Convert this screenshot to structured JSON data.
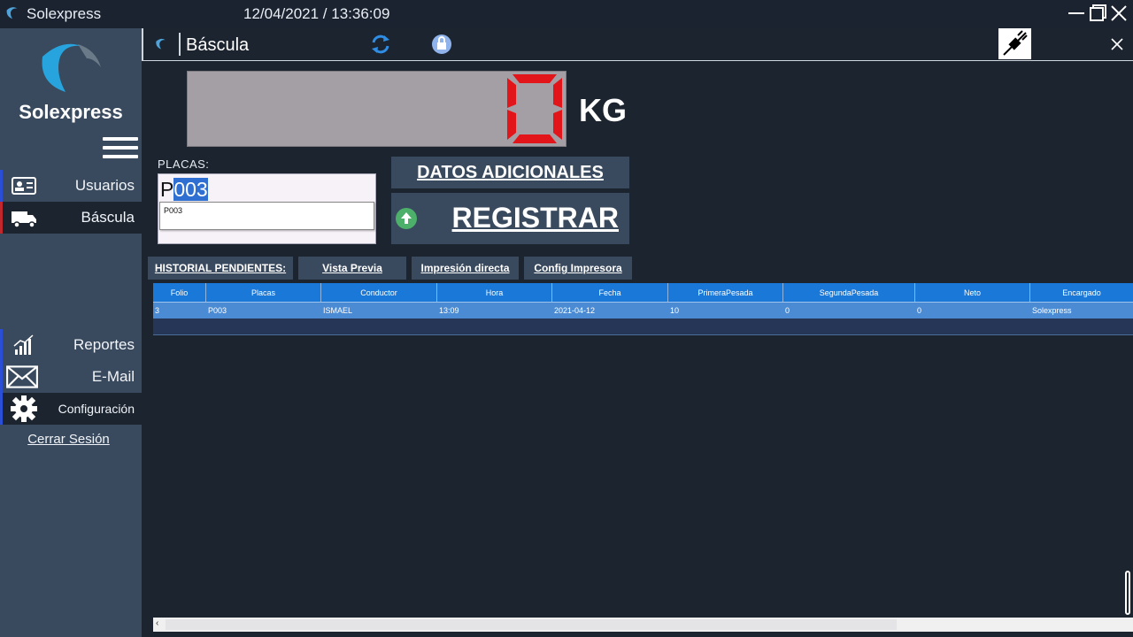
{
  "window": {
    "app_name": "Solexpress",
    "datetime": "12/04/2021 / 13:36:09"
  },
  "sidebar": {
    "brand": "Solexpress",
    "items": [
      {
        "label": "Usuarios",
        "icon": "id-card-icon"
      },
      {
        "label": "Báscula",
        "icon": "truck-icon"
      },
      {
        "label": "Reportes",
        "icon": "bar-chart-icon"
      },
      {
        "label": "E-Mail",
        "icon": "envelope-icon"
      },
      {
        "label": "Configuración",
        "icon": "gear-icon"
      }
    ],
    "logout": "Cerrar Sesión"
  },
  "header": {
    "title": "Báscula"
  },
  "scale": {
    "reading": "0",
    "unit": "KG",
    "digit_color": "#e2151b"
  },
  "form": {
    "placas_label": "PLACAS:",
    "placas_prefix": "P",
    "placas_selected": "003",
    "suggestion": "P003"
  },
  "actions": {
    "datos": "DATOS ADICIONALES",
    "registrar": "REGISTRAR"
  },
  "toolbar": {
    "historial": "HISTORIAL PENDIENTES:",
    "vista_previa": "Vista Previa",
    "impresion": "Impresión directa",
    "config": "Config Impresora"
  },
  "table": {
    "columns": [
      "Folio",
      "Placas",
      "Conductor",
      "Hora",
      "Fecha",
      "PrimeraPesada",
      "SegundaPesada",
      "Neto",
      "Encargado"
    ],
    "rows": [
      [
        "3",
        "P003",
        "ISMAEL",
        "13:09",
        "2021-04-12",
        "10",
        "0",
        "0",
        "Solexpress"
      ]
    ]
  },
  "colors": {
    "accent": "#1a78d8",
    "sidebar": "#3a4a5e",
    "background": "#1c2430"
  }
}
